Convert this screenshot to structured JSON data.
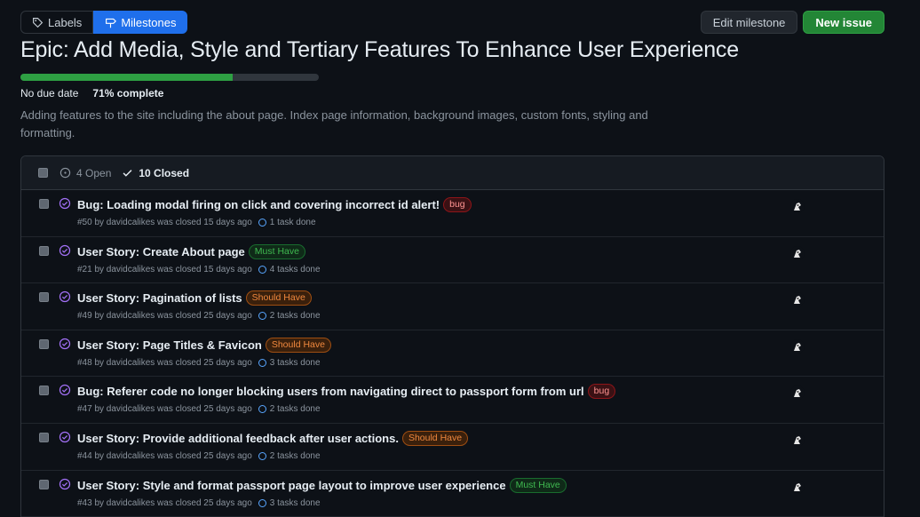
{
  "nav": {
    "labels_label": "Labels",
    "milestones_label": "Milestones",
    "edit_label": "Edit milestone",
    "new_issue_label": "New issue"
  },
  "milestone": {
    "title": "Epic: Add Media, Style and Tertiary Features To Enhance User Experience",
    "due": "No due date",
    "percent_text": "71% complete",
    "progress": 0.71,
    "description": "Adding features to the site including the about page. Index page information, background images, custom fonts, styling and formatting."
  },
  "list": {
    "open_label": "4 Open",
    "closed_label": "10 Closed",
    "issues": [
      {
        "title": "Bug: Loading modal firing on click and covering incorrect id alert!",
        "label": "bug",
        "label_type": "bug",
        "meta": "#50 by davidcalikes was closed 15 days ago",
        "tasks": "1 task done"
      },
      {
        "title": "User Story: Create About page",
        "label": "Must Have",
        "label_type": "must",
        "meta": "#21 by davidcalikes was closed 15 days ago",
        "tasks": "4 tasks done"
      },
      {
        "title": "User Story: Pagination of lists",
        "label": "Should Have",
        "label_type": "should",
        "meta": "#49 by davidcalikes was closed 25 days ago",
        "tasks": "2 tasks done"
      },
      {
        "title": "User Story: Page Titles & Favicon",
        "label": "Should Have",
        "label_type": "should",
        "meta": "#48 by davidcalikes was closed 25 days ago",
        "tasks": "3 tasks done"
      },
      {
        "title": "Bug: Referer code no longer blocking users from navigating direct to passport form from url",
        "label": "bug",
        "label_type": "bug",
        "meta": "#47 by davidcalikes was closed 25 days ago",
        "tasks": "2 tasks done"
      },
      {
        "title": "User Story: Provide additional feedback after user actions.",
        "label": "Should Have",
        "label_type": "should",
        "meta": "#44 by davidcalikes was closed 25 days ago",
        "tasks": "2 tasks done"
      },
      {
        "title": "User Story: Style and format passport page layout to improve user experience",
        "label": "Must Have",
        "label_type": "must",
        "meta": "#43 by davidcalikes was closed 25 days ago",
        "tasks": "3 tasks done"
      }
    ]
  }
}
